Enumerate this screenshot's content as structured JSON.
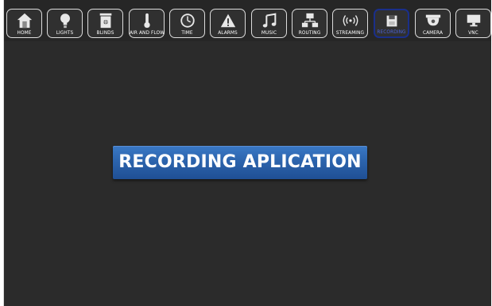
{
  "toolbar": {
    "tabs": [
      {
        "label": "HOME",
        "icon": "house-icon"
      },
      {
        "label": "LIGHTS",
        "icon": "lightbulb-icon"
      },
      {
        "label": "BLINDS",
        "icon": "blinds-icon"
      },
      {
        "label": "AIR AND FLOW",
        "icon": "thermometer-icon"
      },
      {
        "label": "TIME",
        "icon": "clock-icon"
      },
      {
        "label": "ALARMS",
        "icon": "warning-icon"
      },
      {
        "label": "MUSIC",
        "icon": "music-note-icon"
      },
      {
        "label": "ROUTING",
        "icon": "network-icon"
      },
      {
        "label": "STREAMING",
        "icon": "broadcast-icon"
      },
      {
        "label": "RECORDING",
        "icon": "floppy-disk-icon",
        "active": true
      },
      {
        "label": "CAMERA",
        "icon": "dome-camera-icon"
      },
      {
        "label": "VNC",
        "icon": "monitor-icon"
      }
    ]
  },
  "main": {
    "banner_text": "RECORDING APLICATION"
  },
  "colors": {
    "background": "#2b2b2b",
    "active_tab_border": "#1a2f8a",
    "active_tab_label": "#4b63d8",
    "banner": "#2c64ad"
  }
}
